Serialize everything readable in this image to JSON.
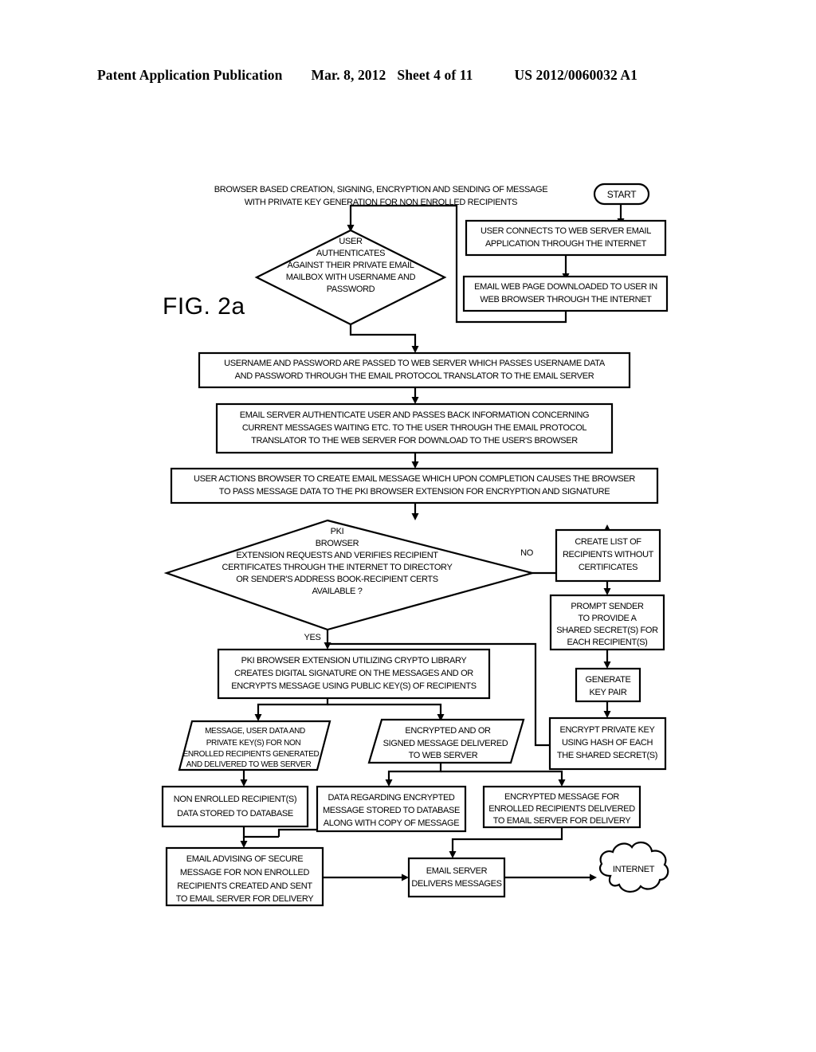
{
  "header": {
    "publication": "Patent Application Publication",
    "date": "Mar. 8, 2012",
    "sheet": "Sheet 4 of 11",
    "number": "US 2012/0060032 A1"
  },
  "figure": {
    "label": "FIG. 2a",
    "title_line1": "BROWSER BASED CREATION, SIGNING, ENCRYPTION AND SENDING OF MESSAGE",
    "title_line2": "WITH PRIVATE KEY GENERATION FOR NON ENROLLED RECIPIENTS"
  },
  "flowchart": {
    "type": "flowchart",
    "nodes": [
      {
        "id": "start",
        "shape": "terminator",
        "lines": [
          "START"
        ]
      },
      {
        "id": "user-connects",
        "shape": "process",
        "lines": [
          "USER CONNECTS TO WEB SERVER EMAIL",
          "APPLICATION THROUGH THE INTERNET"
        ]
      },
      {
        "id": "email-web-page",
        "shape": "process",
        "lines": [
          "EMAIL WEB PAGE DOWNLOADED TO USER IN",
          "WEB BROWSER THROUGH THE INTERNET"
        ]
      },
      {
        "id": "user-authenticates",
        "shape": "decision",
        "lines": [
          "USER",
          "AUTHENTICATES",
          "AGAINST THEIR PRIVATE EMAIL",
          "MAILBOX WITH USERNAME AND",
          "PASSWORD"
        ]
      },
      {
        "id": "username-password-passed",
        "shape": "process",
        "lines": [
          "USERNAME AND PASSWORD ARE PASSED TO WEB SERVER WHICH PASSES USERNAME DATA",
          "AND PASSWORD THROUGH THE EMAIL PROTOCOL TRANSLATOR TO THE EMAIL SERVER"
        ]
      },
      {
        "id": "email-server-authenticate",
        "shape": "process",
        "lines": [
          "EMAIL SERVER AUTHENTICATE USER AND PASSES BACK INFORMATION CONCERNING",
          "CURRENT MESSAGES WAITING ETC. TO THE USER THROUGH THE EMAIL PROTOCOL",
          "TRANSLATOR TO THE WEB SERVER FOR DOWNLOAD TO THE USER'S BROWSER"
        ]
      },
      {
        "id": "user-actions-browser",
        "shape": "process",
        "lines": [
          "USER ACTIONS BROWSER TO CREATE EMAIL MESSAGE WHICH UPON COMPLETION CAUSES THE BROWSER",
          "TO PASS MESSAGE DATA TO THE PKI BROWSER EXTENSION FOR ENCRYPTION AND SIGNATURE"
        ]
      },
      {
        "id": "pki-certs-available",
        "shape": "decision",
        "lines": [
          "PKI",
          "BROWSER",
          "EXTENSION REQUESTS AND VERIFIES RECIPIENT",
          "CERTIFICATES THROUGH THE INTERNET TO DIRECTORY",
          "OR SENDER'S ADDRESS BOOK-RECIPIENT CERTS",
          "AVAILABLE ?"
        ]
      },
      {
        "id": "create-list",
        "shape": "process",
        "lines": [
          "CREATE LIST OF",
          "RECIPIENTS WITHOUT",
          "CERTIFICATES"
        ]
      },
      {
        "id": "prompt-sender",
        "shape": "process",
        "lines": [
          "PROMPT SENDER",
          "TO PROVIDE A",
          "SHARED SECRET(S) FOR",
          "EACH RECIPIENT(S)"
        ]
      },
      {
        "id": "generate-key-pair",
        "shape": "process",
        "lines": [
          "GENERATE",
          "KEY PAIR"
        ]
      },
      {
        "id": "encrypt-private-key",
        "shape": "process",
        "lines": [
          "ENCRYPT PRIVATE KEY",
          "USING HASH OF EACH",
          "THE SHARED SECRET(S)"
        ]
      },
      {
        "id": "pki-extension-crypto",
        "shape": "process",
        "lines": [
          "PKI BROWSER EXTENSION UTILIZING CRYPTO LIBRARY",
          "CREATES DIGITAL SIGNATURE ON THE MESSAGES AND OR",
          "ENCRYPTS MESSAGE USING PUBLIC KEY(S) OF RECIPIENTS"
        ]
      },
      {
        "id": "message-user-data",
        "shape": "data",
        "lines": [
          "MESSAGE, USER DATA AND",
          "PRIVATE KEY(S) FOR NON",
          "ENROLLED RECIPIENTS GENERATED",
          "AND DELIVERED TO WEB SERVER"
        ]
      },
      {
        "id": "encrypted-signed-delivered",
        "shape": "data",
        "lines": [
          "ENCRYPTED AND OR",
          "SIGNED MESSAGE DELIVERED",
          "TO WEB SERVER"
        ]
      },
      {
        "id": "non-enrolled-stored",
        "shape": "process",
        "lines": [
          "NON ENROLLED RECIPIENT(S)",
          "DATA STORED TO DATABASE"
        ]
      },
      {
        "id": "data-regarding-encrypted",
        "shape": "process",
        "lines": [
          "DATA REGARDING ENCRYPTED",
          "MESSAGE STORED TO DATABASE",
          "ALONG WITH COPY OF MESSAGE"
        ]
      },
      {
        "id": "encrypted-message-enrolled",
        "shape": "process",
        "lines": [
          "ENCRYPTED MESSAGE FOR",
          "ENROLLED RECIPIENTS DELIVERED",
          "TO EMAIL SERVER FOR DELIVERY"
        ]
      },
      {
        "id": "email-advising",
        "shape": "process",
        "lines": [
          "EMAIL ADVISING OF SECURE",
          "MESSAGE FOR NON ENROLLED",
          "RECIPIENTS CREATED AND SENT",
          "TO EMAIL SERVER FOR DELIVERY"
        ]
      },
      {
        "id": "email-server-delivers",
        "shape": "process",
        "lines": [
          "EMAIL SERVER",
          "DELIVERS MESSAGES"
        ]
      },
      {
        "id": "internet",
        "shape": "cloud",
        "lines": [
          "INTERNET"
        ]
      }
    ],
    "edge_labels": {
      "no": "NO",
      "yes": "YES"
    }
  }
}
